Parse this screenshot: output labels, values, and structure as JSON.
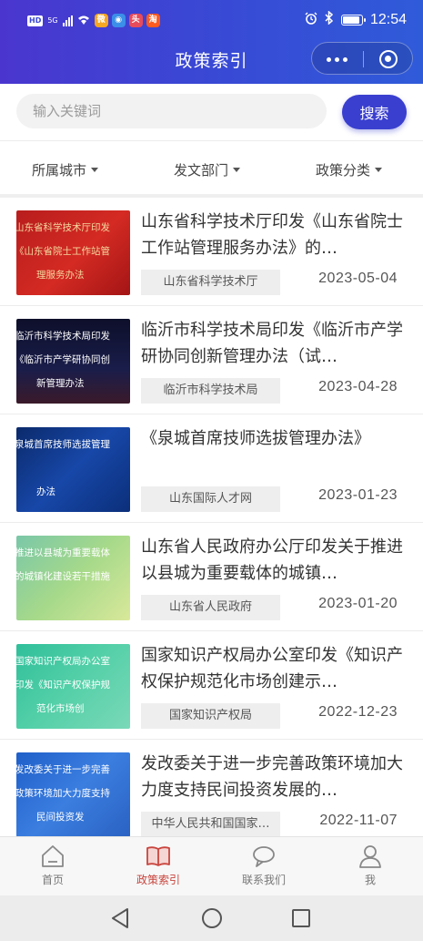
{
  "status_bar": {
    "network_tag": "HD",
    "signal_tag": "5G",
    "time": "12:54",
    "apps": [
      {
        "name": "weibo-app-icon",
        "glyph": "微",
        "color": "#f5a623"
      },
      {
        "name": "browser-app-icon",
        "glyph": "◉",
        "color": "#3b8fe8"
      },
      {
        "name": "news-app-icon",
        "glyph": "头",
        "color": "#e84b5b"
      },
      {
        "name": "taobao-app-icon",
        "glyph": "淘",
        "color": "#ff5a1f"
      }
    ]
  },
  "header": {
    "title": "政策索引"
  },
  "search": {
    "placeholder": "输入关键词",
    "button_label": "搜索"
  },
  "filters": [
    "所属城市",
    "发文部门",
    "政策分类"
  ],
  "colors": {
    "header_start": "#4a36cf",
    "header_end": "#2f5bd9",
    "button": "#3a3fcf",
    "active_tab": "#c8453e"
  },
  "policies": [
    {
      "title": "山东省科学技术厅印发《山东省院士工作站管理服务办法》的…",
      "source": "山东省科学技术厅",
      "date": "2023-05-04",
      "thumb_lines": [
        "山东省科学技术厅印发",
        "《山东省院士工作站管",
        "理服务办法"
      ],
      "thumb_bg": "linear-gradient(135deg,#b81d1d 0%,#d42a23 55%,#a31515 100%)",
      "thumb_color": "#f3d9a0"
    },
    {
      "title": "临沂市科学技术局印发《临沂市产学研协同创新管理办法（试…",
      "source": "临沂市科学技术局",
      "date": "2023-04-28",
      "thumb_lines": [
        "临沂市科学技术局印发",
        "《临沂市产学研协同创",
        "新管理办法"
      ],
      "thumb_bg": "linear-gradient(180deg,#0d0f2a 0%,#1a1d4a 60%,#3b1a2a 100%)",
      "thumb_color": "#ffffff"
    },
    {
      "title": "《泉城首席技师选拔管理办法》",
      "source": "山东国际人才网",
      "date": "2023-01-23",
      "thumb_lines": [
        "泉城首席技师选拔管理",
        "",
        "办法"
      ],
      "thumb_bg": "linear-gradient(135deg,#0b2a6b 0%,#1747a8 50%,#0b2f7a 100%)",
      "thumb_color": "#ffffff"
    },
    {
      "title": "山东省人民政府办公厅印发关于推进以县城为重要载体的城镇…",
      "source": "山东省人民政府",
      "date": "2023-01-20",
      "thumb_lines": [
        "推进以县城为重要载体",
        "的城镇化建设若干措施",
        ""
      ],
      "thumb_bg": "linear-gradient(135deg,#7ac7a8 0%,#a6d98a 50%,#d9e89a 100%)",
      "thumb_color": "#ffffff"
    },
    {
      "title": "国家知识产权局办公室印发《知识产权保护规范化市场创建示…",
      "source": "国家知识产权局",
      "date": "2022-12-23",
      "thumb_lines": [
        "国家知识产权局办公室",
        "印发《知识产权保护规",
        "范化市场创"
      ],
      "thumb_bg": "linear-gradient(135deg,#2fbf9a 0%,#55d0a8 50%,#7ad8b8 100%)",
      "thumb_color": "#ffffff"
    },
    {
      "title": "发改委关于进一步完善政策环境加大力度支持民间投资发展的…",
      "source": "中华人民共和国国家…",
      "date": "2022-11-07",
      "thumb_lines": [
        "发改委关于进一步完善",
        "政策环境加大力度支持",
        "民间投资发"
      ],
      "thumb_bg": "linear-gradient(135deg,#1f5fc9 0%,#3b7ee0 50%,#2a62c2 100%)",
      "thumb_color": "#ffffff"
    }
  ],
  "tabs": [
    {
      "label": "首页",
      "icon": "home-icon",
      "active": false
    },
    {
      "label": "政策索引",
      "icon": "book-icon",
      "active": true
    },
    {
      "label": "联系我们",
      "icon": "chat-icon",
      "active": false
    },
    {
      "label": "我",
      "icon": "user-icon",
      "active": false
    }
  ]
}
